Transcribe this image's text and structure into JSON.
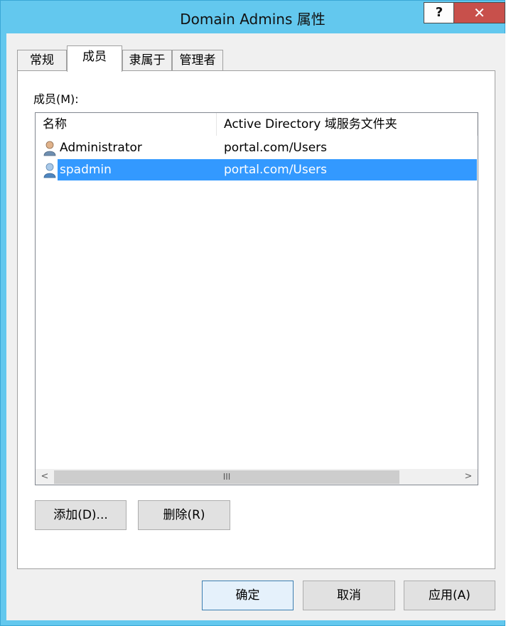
{
  "window": {
    "title": "Domain Admins 属性",
    "help_label": "?",
    "close_label": "✕"
  },
  "tabs": [
    {
      "label": "常规"
    },
    {
      "label": "成员",
      "active": true
    },
    {
      "label": "隶属于"
    },
    {
      "label": "管理者"
    }
  ],
  "members": {
    "label": "成员(M):",
    "columns": [
      "名称",
      "Active Directory 域服务文件夹"
    ],
    "rows": [
      {
        "name": "Administrator",
        "folder": "portal.com/Users",
        "icon": "user-icon"
      },
      {
        "name": "spadmin",
        "folder": "portal.com/Users",
        "icon": "user-icon",
        "selected": true
      }
    ],
    "scroll_left": "<",
    "scroll_right": ">",
    "scroll_grip": "III"
  },
  "buttons": {
    "add": "添加(D)...",
    "remove": "删除(R)"
  },
  "footer": {
    "ok": "确定",
    "cancel": "取消",
    "apply": "应用(A)"
  },
  "colors": {
    "titlebar": "#63c8ee",
    "close": "#c8504b",
    "selection": "#3399ff"
  }
}
